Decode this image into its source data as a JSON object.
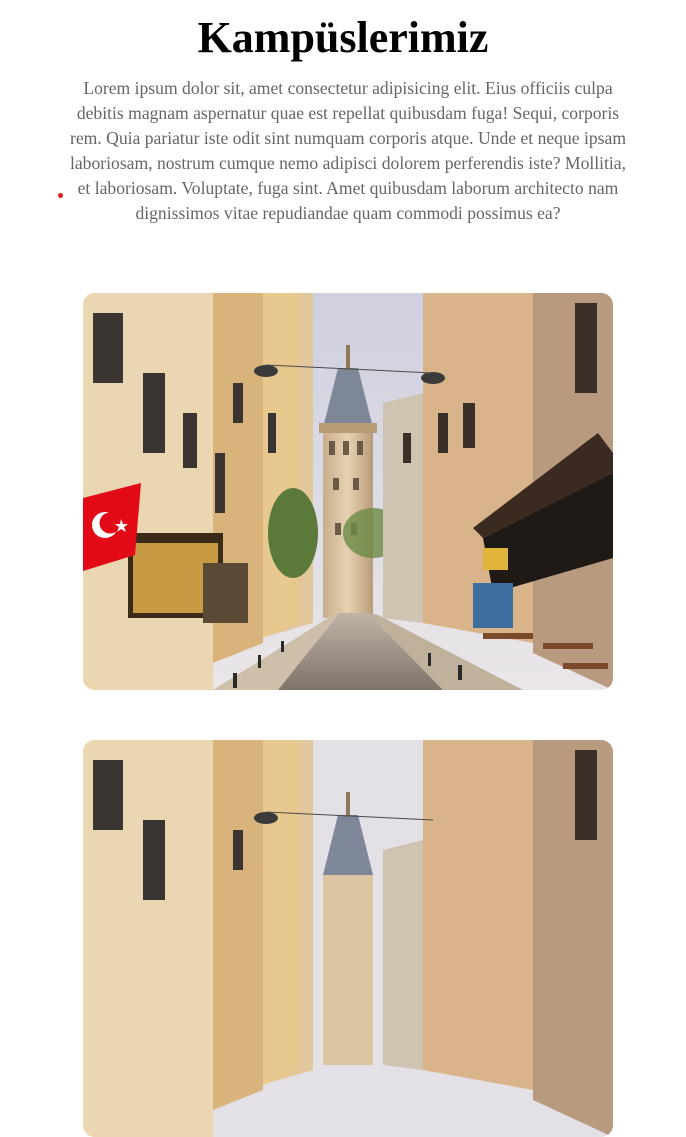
{
  "page": {
    "title": "Kampüslerimiz",
    "intro": "Lorem ipsum dolor sit, amet consectetur adipisicing elit. Eius officiis culpa debitis magnam aspernatur quae est repellat quibusdam fuga! Sequi, corporis rem. Quia pariatur iste odit sint numquam corporis atque. Unde et neque ipsam laboriosam, nostrum cumque nemo adipisci dolorem perferendis iste? Mollitia, et laboriosam. Voluptate, fuga sint. Amet quibusdam laborum architecto nam dignissimos vitae repudiandae quam commodi possimus ea?"
  },
  "campuses": [
    {
      "image": "galata-tower-street-photo"
    },
    {
      "image": "galata-tower-street-photo"
    }
  ],
  "colors": {
    "heading": "#000000",
    "body_text": "#666666",
    "accent_dot": "#e02020",
    "flag_red": "#e30a17"
  }
}
